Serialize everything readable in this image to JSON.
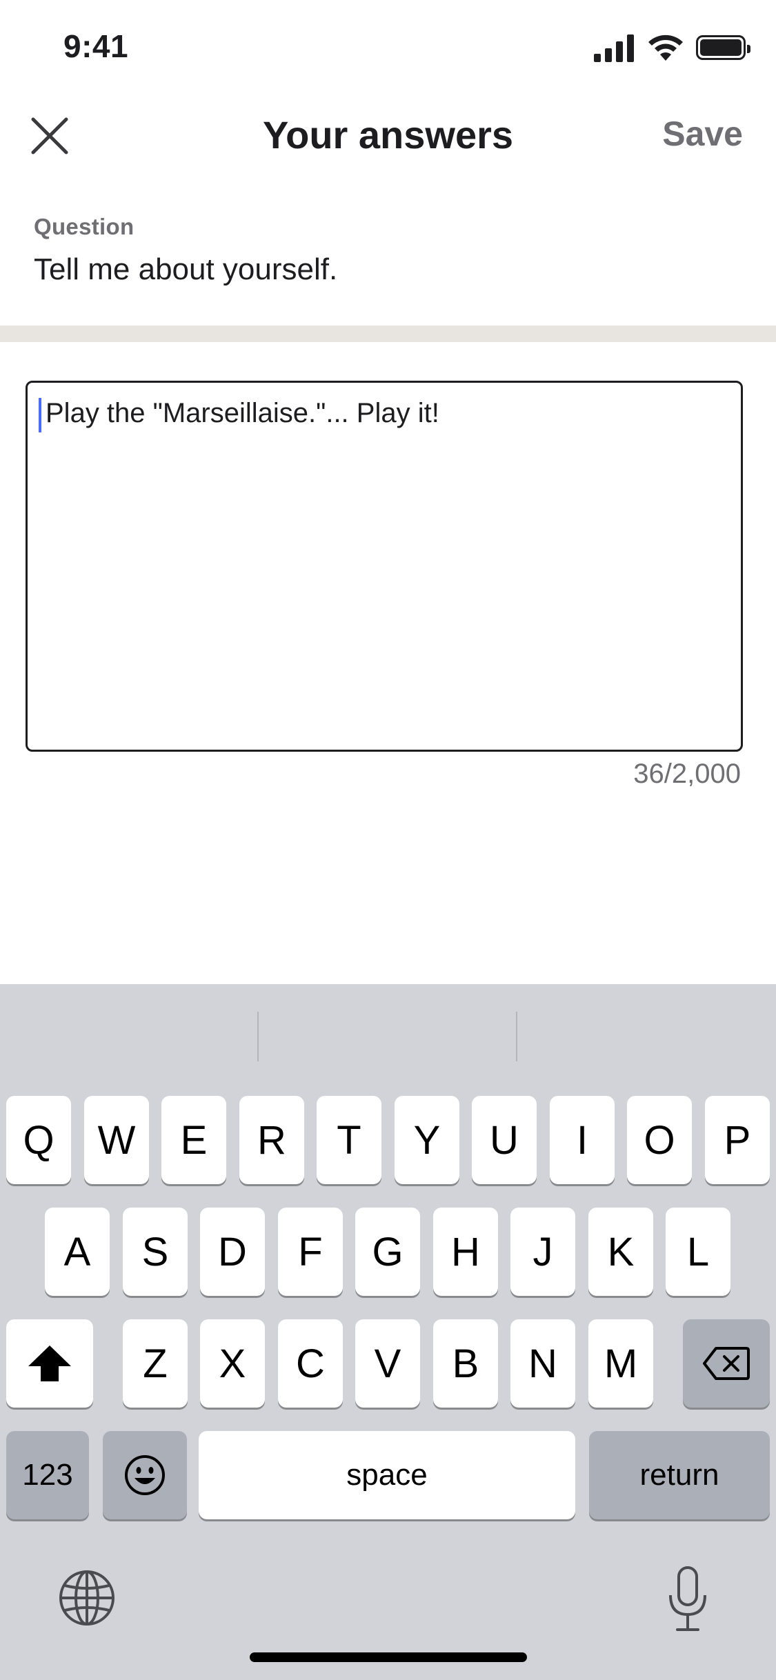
{
  "status_bar": {
    "time": "9:41"
  },
  "nav": {
    "title": "Your answers",
    "save_label": "Save"
  },
  "question": {
    "label": "Question",
    "text": "Tell me about yourself."
  },
  "answer": {
    "text": "Play the \"Marseillaise.\"... Play it!",
    "counter": "36/2,000"
  },
  "keyboard": {
    "row1": [
      "Q",
      "W",
      "E",
      "R",
      "T",
      "Y",
      "U",
      "I",
      "O",
      "P"
    ],
    "row2": [
      "A",
      "S",
      "D",
      "F",
      "G",
      "H",
      "J",
      "K",
      "L"
    ],
    "row3": [
      "Z",
      "X",
      "C",
      "V",
      "B",
      "N",
      "M"
    ],
    "numbers_label": "123",
    "space_label": "space",
    "return_label": "return"
  },
  "colors": {
    "caret": "#4a6cf7",
    "keyboard_bg": "#d1d3d9",
    "divider": "#e8e4e0"
  }
}
